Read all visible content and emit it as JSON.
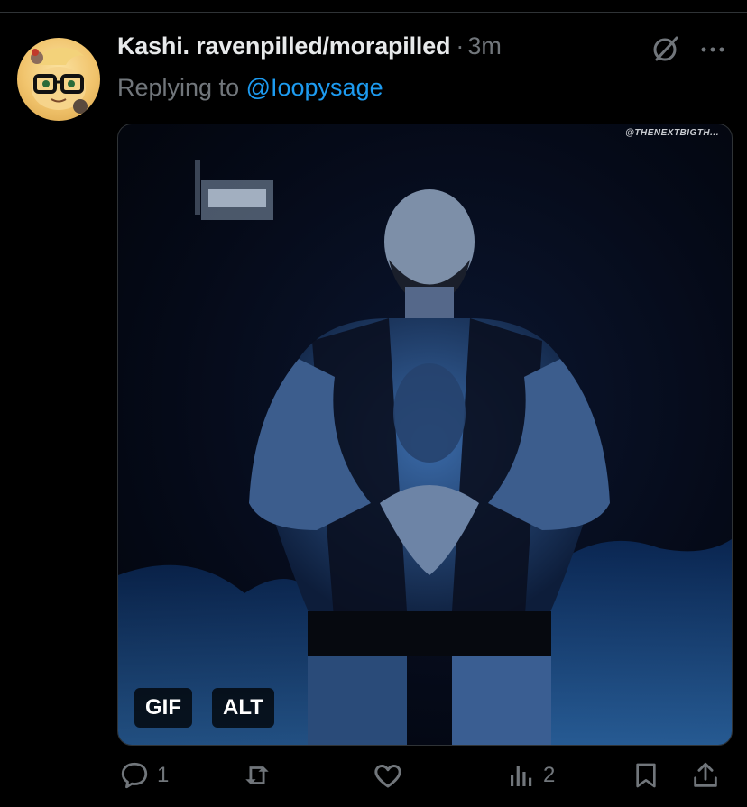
{
  "tweet": {
    "display_name": "Kashi. ravenpilled/morapilled",
    "separator": "·",
    "time": "3m",
    "reply_prefix": "Replying to ",
    "reply_handle": "@Ioopysage",
    "avatar_icon": "pony-with-glasses-avatar",
    "menu_icons": [
      "grok-icon",
      "more-icon"
    ]
  },
  "media": {
    "watermark": "@THENEXTBIGTH...",
    "gif_label": "GIF",
    "alt_label": "ALT",
    "description_icon": "wrestler-entrance-gif"
  },
  "actions": {
    "reply_count": "1",
    "repost_count": "",
    "like_count": "",
    "views_count": "2",
    "icons": [
      "reply-icon",
      "repost-icon",
      "like-icon",
      "views-icon",
      "bookmark-icon",
      "share-icon"
    ]
  },
  "colors": {
    "background": "#000000",
    "text_primary": "#e7e9ea",
    "text_secondary": "#71767b",
    "link": "#1d9bf0",
    "divider": "#2f3336"
  }
}
